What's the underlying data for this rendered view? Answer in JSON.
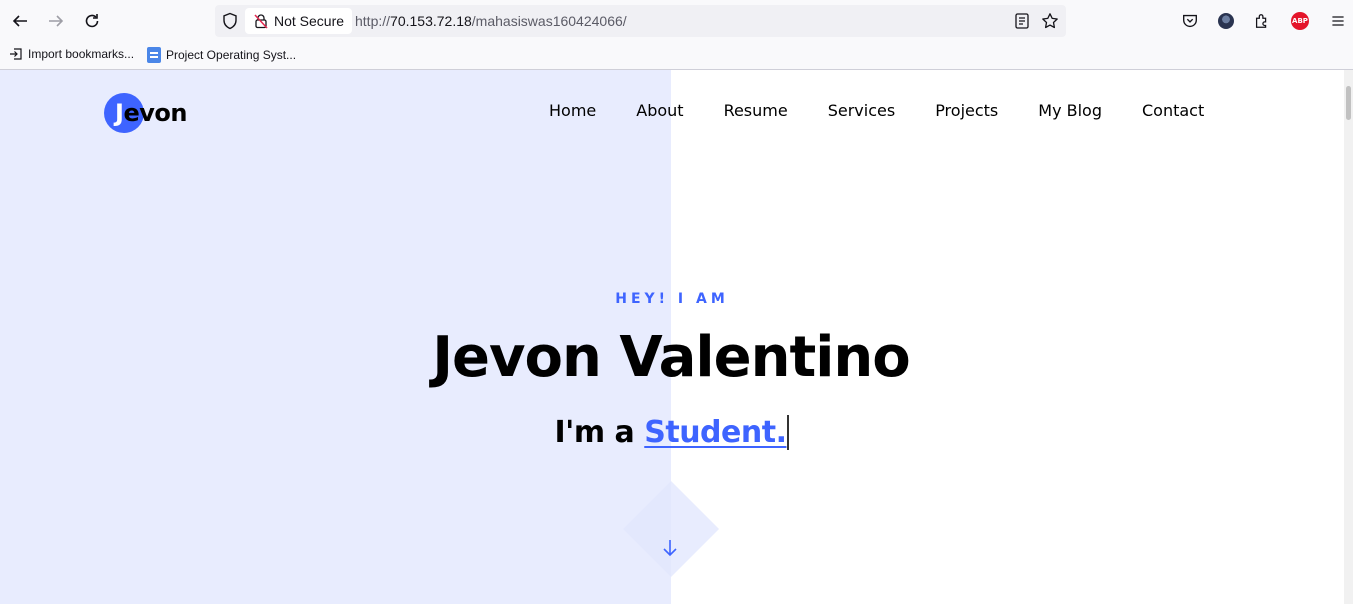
{
  "browser": {
    "security_label": "Not Secure",
    "url_prefix": "http://",
    "url_host": "70.153.72.18",
    "url_path": "/mahasiswas160424066/",
    "bookmarks": [
      {
        "label": "Import bookmarks..."
      },
      {
        "label": "Project Operating Syst..."
      }
    ],
    "abp_label": "ABP"
  },
  "site": {
    "logo_first": "J",
    "logo_rest": "evon",
    "menu": [
      "Home",
      "About",
      "Resume",
      "Services",
      "Projects",
      "My Blog",
      "Contact"
    ],
    "hero": {
      "greeting": "HEY! I AM",
      "name": "Jevon Valentino",
      "role_prefix": "I'm a ",
      "role_typed": "Student."
    },
    "colors": {
      "accent": "#3e64ff",
      "left_panel": "#e8ecfe"
    }
  }
}
